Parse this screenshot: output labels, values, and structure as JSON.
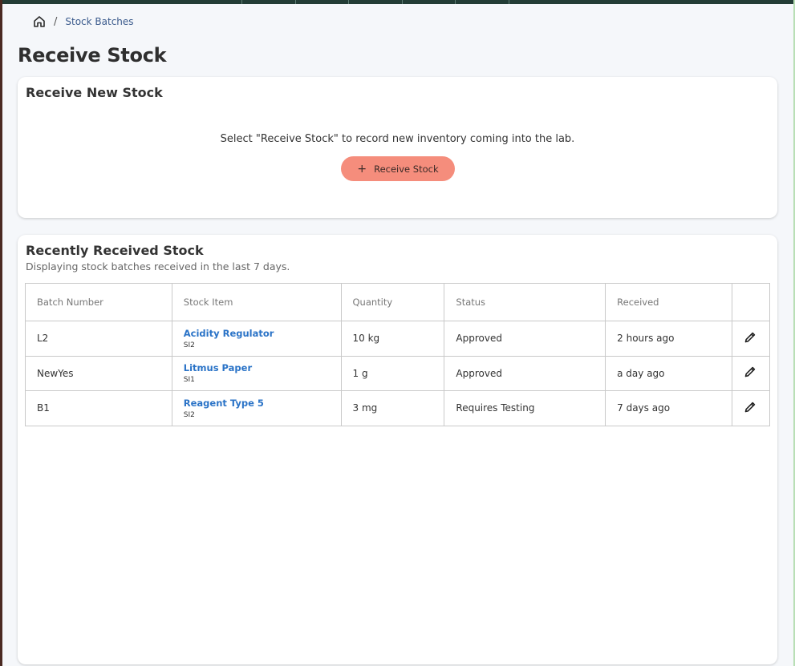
{
  "breadcrumb": {
    "home_icon": "home-icon",
    "items": [
      {
        "label": "Stock Batches"
      }
    ]
  },
  "page": {
    "title": "Receive Stock"
  },
  "receive_card": {
    "title": "Receive New Stock",
    "message": "Select \"Receive Stock\" to record new inventory coming into the lab.",
    "button_label": "Receive Stock",
    "button_icon": "plus-icon",
    "button_color": "#f58d7c"
  },
  "recent_card": {
    "title": "Recently Received Stock",
    "subtitle": "Displaying stock batches received in the last 7 days.",
    "columns": [
      "Batch Number",
      "Stock Item",
      "Quantity",
      "Status",
      "Received",
      ""
    ],
    "rows": [
      {
        "batch": "L2",
        "item_name": "Acidity Regulator",
        "item_code": "SI2",
        "quantity": "10 kg",
        "status": "Approved",
        "received": "2 hours ago"
      },
      {
        "batch": "NewYes",
        "item_name": "Litmus Paper",
        "item_code": "SI1",
        "quantity": "1 g",
        "status": "Approved",
        "received": "a day ago"
      },
      {
        "batch": "B1",
        "item_name": "Reagent Type 5",
        "item_code": "SI2",
        "quantity": "3 mg",
        "status": "Requires Testing",
        "received": "7 days ago"
      }
    ],
    "row_action_icon": "pencil-icon"
  },
  "colors": {
    "link": "#2a73c7",
    "accent": "#f58d7c",
    "topbar": "#233d36"
  }
}
